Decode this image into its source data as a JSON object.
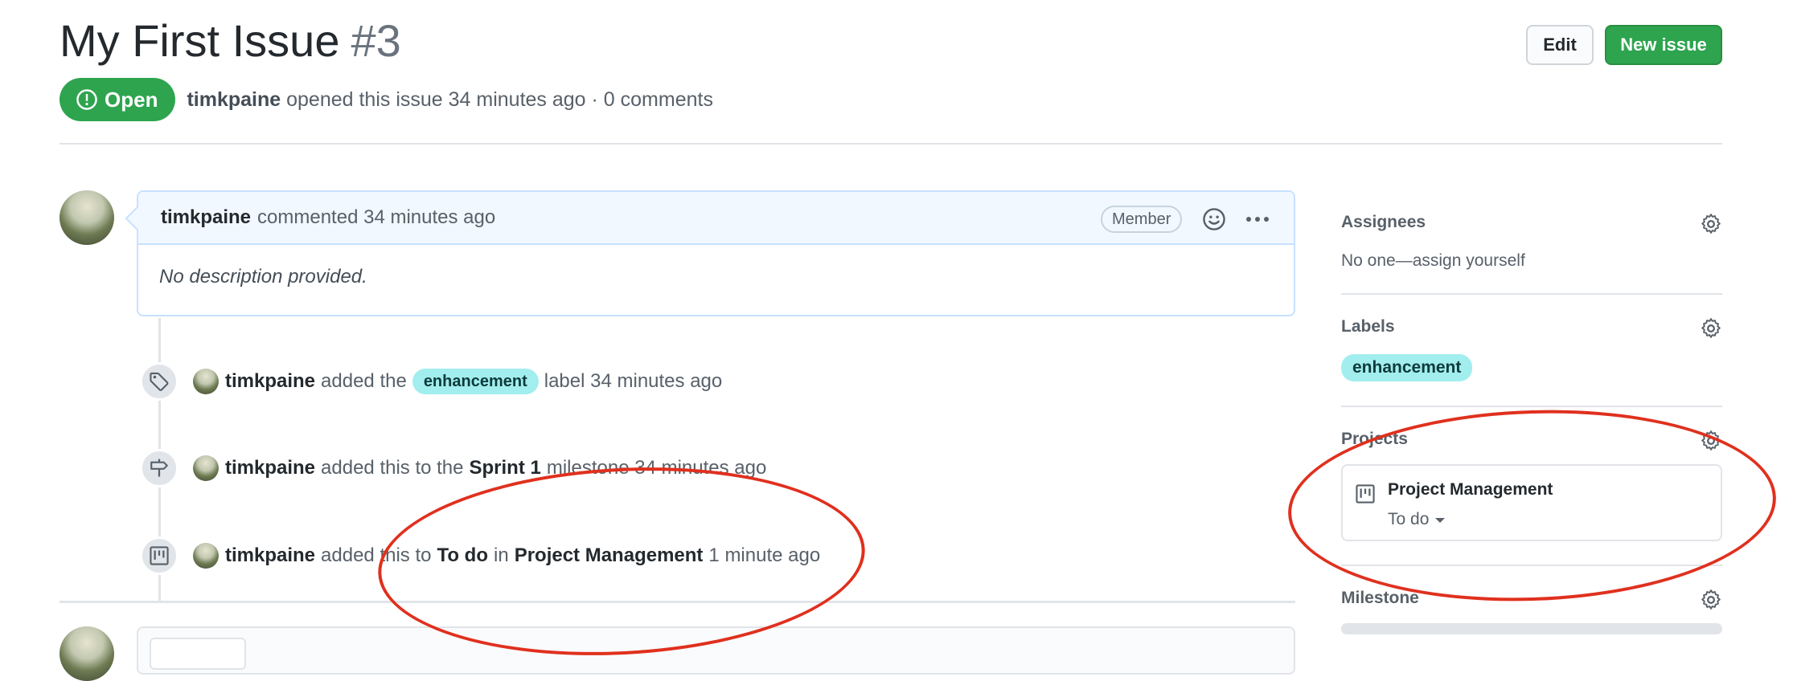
{
  "header": {
    "title": "My First Issue",
    "number": "#3",
    "edit_label": "Edit",
    "new_issue_label": "New issue",
    "status_label": "Open",
    "author": "timkpaine",
    "opened_text": "opened this issue 34 minutes ago · 0 comments"
  },
  "comment": {
    "author": "timkpaine",
    "meta": "commented 34 minutes ago",
    "badge": "Member",
    "body": "No description provided."
  },
  "timeline": [
    {
      "icon": "tag-icon",
      "author": "timkpaine",
      "pre": "added the",
      "label": "enhancement",
      "post": "label 34 minutes ago"
    },
    {
      "icon": "milestone-icon",
      "author": "timkpaine",
      "pre": "added this to the",
      "target": "Sprint 1",
      "post": "milestone 34 minutes ago"
    },
    {
      "icon": "project-icon",
      "author": "timkpaine",
      "pre": "added this to",
      "column": "To do",
      "mid": "in",
      "project": "Project Management",
      "post": "1 minute ago"
    }
  ],
  "sidebar": {
    "assignees": {
      "title": "Assignees",
      "value": "No one—assign yourself"
    },
    "labels": {
      "title": "Labels",
      "items": [
        "enhancement"
      ]
    },
    "projects": {
      "title": "Projects",
      "project_name": "Project Management",
      "column": "To do"
    },
    "milestone": {
      "title": "Milestone"
    }
  },
  "colors": {
    "open_green": "#2ea44f",
    "label_enhancement": "#a2eeef",
    "annotation_red": "#e0301e"
  }
}
